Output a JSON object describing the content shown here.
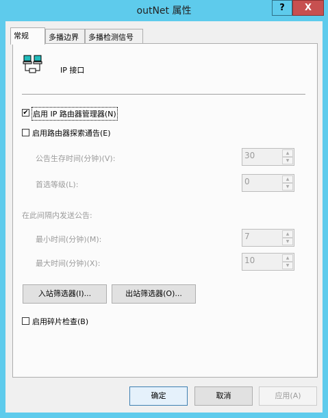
{
  "window": {
    "title": "outNet 属性",
    "help": "?",
    "close": "X"
  },
  "tabs": [
    {
      "label": "常规",
      "selected": true
    },
    {
      "label": "多播边界"
    },
    {
      "label": "多播检测信号"
    }
  ],
  "header": {
    "label": "IP 接口",
    "icon": "network-computers-icon"
  },
  "options": {
    "enable_router_manager": {
      "label": "启用 IP 路由器管理器(N)",
      "checked": true
    },
    "enable_discovery": {
      "label": "启用路由器探索通告(E)",
      "checked": false
    },
    "lifetime": {
      "label": "公告生存时间(分钟)(V):",
      "value": "30"
    },
    "preference": {
      "label": "首选等级(L):",
      "value": "0"
    },
    "interval_label": "在此间隔内发送公告:",
    "min_time": {
      "label": "最小时间(分钟)(M):",
      "value": "7"
    },
    "max_time": {
      "label": "最大时间(分钟)(X):",
      "value": "10"
    },
    "inbound_filter": "入站筛选器(I)...",
    "outbound_filter": "出站筛选器(O)...",
    "fragment_check": {
      "label": "启用碎片检查(B)",
      "checked": false
    }
  },
  "footer": {
    "ok": "确定",
    "cancel": "取消",
    "apply": "应用(A)"
  }
}
